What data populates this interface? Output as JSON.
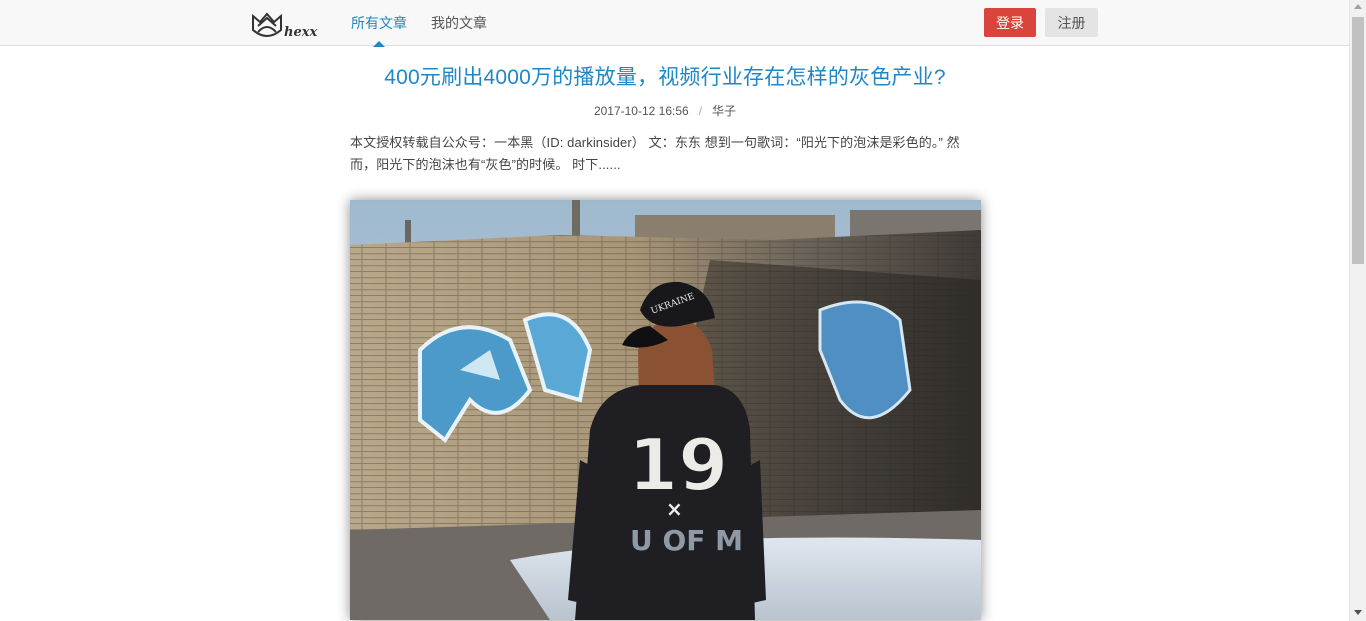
{
  "header": {
    "logo_text": "hexx",
    "tabs": [
      {
        "label": "所有文章",
        "active": true
      },
      {
        "label": "我的文章",
        "active": false
      }
    ],
    "login_label": "登录",
    "register_label": "注册"
  },
  "article": {
    "title": "400元刷出4000万的播放量，视频行业存在怎样的灰色产业?",
    "date": "2017-10-12 16:56",
    "separator": "/",
    "author": "华子",
    "excerpt": "本文授权转载自公众号：一本黑（ID: darkinsider） 文：东东 想到一句歌词：“阳光下的泡沫是彩色的。” 然而，阳光下的泡沫也有“灰色”的时候。 时下......",
    "image": {
      "description_icon": "photo-graffiti-wall",
      "jersey_number": "19",
      "jersey_mark": "×",
      "jersey_text": "U OF M",
      "cap_text": "UKRAINE"
    }
  },
  "colors": {
    "accent": "#1e88c7",
    "login": "#d9453c",
    "register": "#e4e4e4"
  }
}
